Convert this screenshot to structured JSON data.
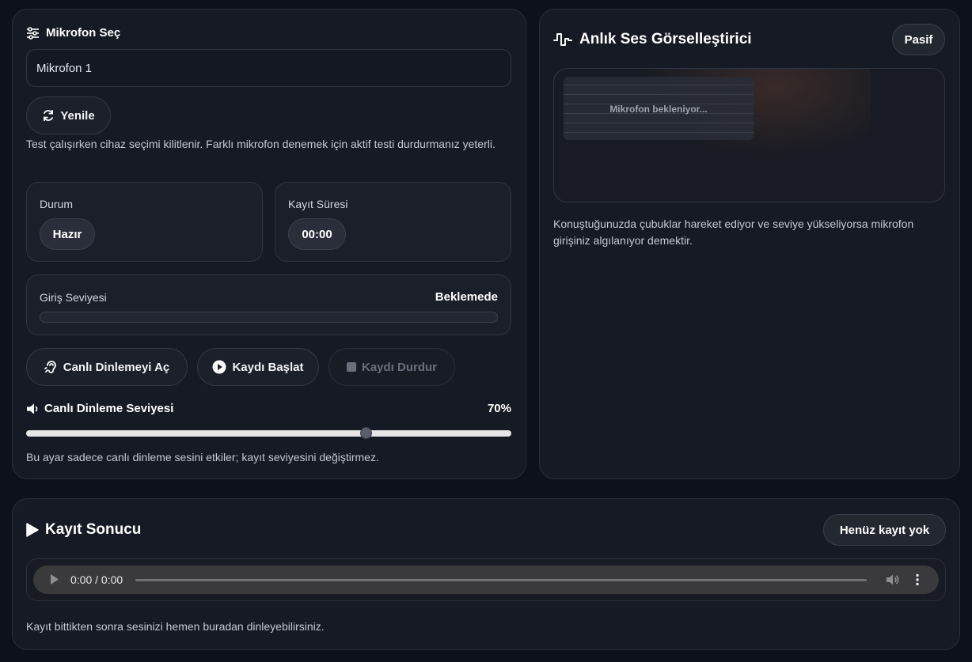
{
  "mic_panel": {
    "title": "Mikrofon Seç",
    "selected_device": "Mikrofon 1",
    "refresh_label": "Yenile",
    "lock_note": "Test çalışırken cihaz seçimi kilitlenir. Farklı mikrofon denemek için aktif testi durdurmanız yeterli.",
    "status_label": "Durum",
    "status_value": "Hazır",
    "duration_label": "Kayıt Süresi",
    "duration_value": "00:00",
    "input_level_label": "Giriş Seviyesi",
    "input_level_status": "Beklemede",
    "input_level_fraction": 0,
    "live_listen_label": "Canlı Dinlemeyi Aç",
    "start_record_label": "Kaydı Başlat",
    "stop_record_label": "Kaydı Durdur",
    "live_volume_label": "Canlı Dinleme Seviyesi",
    "live_volume_value": "70%",
    "live_volume_fraction": 0.7,
    "volume_note": "Bu ayar sadece canlı dinleme sesini etkiler; kayıt seviyesini değiştirmez."
  },
  "visualizer_panel": {
    "title": "Anlık Ses Görselleştirici",
    "state_badge": "Pasif",
    "placeholder": "Mikrofon bekleniyor...",
    "note": "Konuştuğunuzda çubuklar hareket ediyor ve seviye yükseliyorsa mikrofon girişiniz algılanıyor demektir."
  },
  "result_panel": {
    "title": "Kayıt Sonucu",
    "state_badge": "Henüz kayıt yok",
    "player_time": "0:00 / 0:00",
    "note": "Kayıt bittikten sonra sesinizi hemen buradan dinleyebilirsiniz."
  },
  "icons": {
    "mic_section": "sliders-icon",
    "refresh": "refresh-icon",
    "live_listen": "ear-icon",
    "start_record": "play-circle-icon",
    "stop_record": "stop-square-icon",
    "volume": "speaker-icon",
    "visualizer": "waveform-icon",
    "result": "play-triangle-icon"
  },
  "colors": {
    "background": "#0d1119",
    "card": "#161a24",
    "accent_glow": "#3a2a22"
  }
}
